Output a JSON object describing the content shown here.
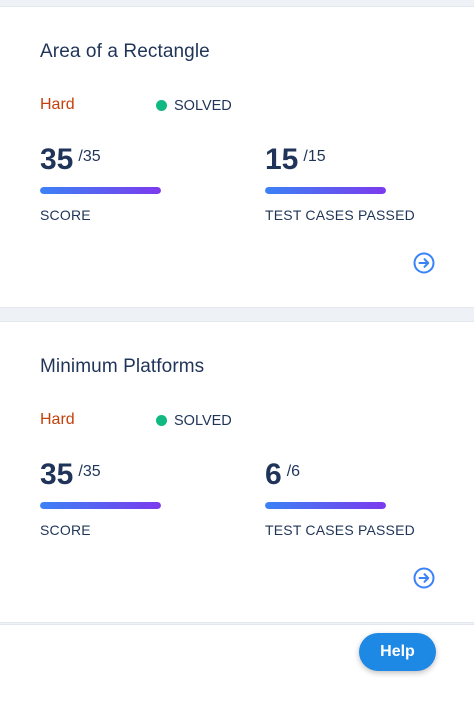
{
  "problems": [
    {
      "title": "Area of a Rectangle",
      "difficulty": "Hard",
      "status": "SOLVED",
      "score": {
        "value": "35",
        "total": "/35",
        "label": "SCORE",
        "progress": 1.0
      },
      "tests": {
        "value": "15",
        "total": "/15",
        "label": "TEST CASES PASSED",
        "progress": 1.0
      },
      "open_icon": "arrow-right-circle-icon"
    },
    {
      "title": "Minimum Platforms",
      "difficulty": "Hard",
      "status": "SOLVED",
      "score": {
        "value": "35",
        "total": "/35",
        "label": "SCORE",
        "progress": 1.0
      },
      "tests": {
        "value": "6",
        "total": "/6",
        "label": "TEST CASES PASSED",
        "progress": 1.0
      },
      "open_icon": "arrow-right-circle-icon"
    }
  ],
  "help_button": {
    "label": "Help"
  },
  "colors": {
    "title": "#1f3458",
    "difficulty_hard": "#c2410c",
    "solved_dot": "#10b981",
    "bar_start": "#3b82f6",
    "bar_end": "#7c3aed",
    "accent": "#1e88e5"
  }
}
